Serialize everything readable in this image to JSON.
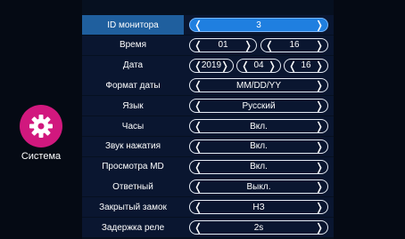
{
  "sidebar": {
    "label": "Система",
    "icon": "gear-icon",
    "icon_color": "#d1187e"
  },
  "settings": [
    {
      "label": "ID монитора",
      "values": [
        "3"
      ],
      "selected": true
    },
    {
      "label": "Время",
      "values": [
        "01",
        "16"
      ]
    },
    {
      "label": "Дата",
      "values": [
        "2019",
        "04",
        "16"
      ]
    },
    {
      "label": "Формат даты",
      "values": [
        "MM/DD/YY"
      ]
    },
    {
      "label": "Язык",
      "values": [
        "Русский"
      ]
    },
    {
      "label": "Часы",
      "values": [
        "Вкл."
      ]
    },
    {
      "label": "Звук нажатия",
      "values": [
        "Вкл."
      ]
    },
    {
      "label": "Просмотра MD",
      "values": [
        "Вкл."
      ]
    },
    {
      "label": "Ответный",
      "values": [
        "Выкл."
      ]
    },
    {
      "label": "Закрытый замок",
      "values": [
        "НЗ"
      ]
    },
    {
      "label": "Задержка реле",
      "values": [
        "2s"
      ]
    }
  ],
  "colors": {
    "accent": "#1f7fe0",
    "selected_row": "#1f5f9e",
    "row_bg": "#0a1630"
  }
}
